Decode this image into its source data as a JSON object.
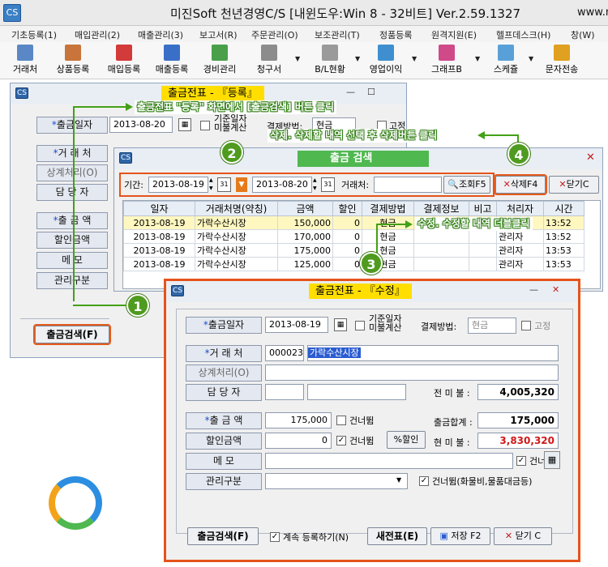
{
  "app": {
    "title": "미진Soft 천년경영C/S [내윈도우:Win 8 - 32비트] Ver.2.59.1327",
    "title_suffix": "www.m",
    "icon_text": "CS"
  },
  "menu": [
    "기초등록(1)",
    "매입관리(2)",
    "매출관리(3)",
    "보고서(R)",
    "주문관리(O)",
    "보조관리(T)",
    "정품등록",
    "원격지원(E)",
    "헬프데스크(H)",
    "창(W)"
  ],
  "toolbar": [
    "거래처",
    "상품등록",
    "매입등록",
    "매출등록",
    "경비관리",
    "청구서",
    "B/L현황",
    "영업이익",
    "그래프B",
    "스케쥴",
    "문자전송"
  ],
  "register": {
    "title": "출금전표 - 『등록』",
    "date_label": "출금일자",
    "date_value": "2013-08-20",
    "base_date_line1": "기준일자",
    "base_date_line2": "미불계산",
    "pay_method_label": "결제방법:",
    "pay_method_value": "현금",
    "fixed_label": "고정",
    "customer_label": "거 래 처",
    "offset_label": "상계처리(O)",
    "manager_label": "담 당 자",
    "amount_label": "출 금 액",
    "discount_label": "할인금액",
    "memo_label": "메    모",
    "class_label": "관리구분",
    "search_button": "출금검색(F)"
  },
  "search": {
    "title": "출금 검색",
    "period_label": "기간:",
    "date_from": "2013-08-19",
    "date_to": "2013-08-20",
    "customer_label": "거래처:",
    "query_button": "조회F5",
    "delete_button": "삭제F4",
    "close_button": "닫기C",
    "columns": [
      "일자",
      "거래처명(약칭)",
      "금액",
      "할인",
      "결제방법",
      "결제정보",
      "비고",
      "처리자",
      "시간"
    ],
    "rows": [
      [
        "2013-08-19",
        "가락수산시장",
        "150,000",
        "0",
        "현금",
        "",
        "",
        "관리자",
        "13:52"
      ],
      [
        "2013-08-19",
        "가락수산시장",
        "170,000",
        "0",
        "현금",
        "",
        "",
        "관리자",
        "13:52"
      ],
      [
        "2013-08-19",
        "가락수산시장",
        "175,000",
        "0",
        "현금",
        "",
        "",
        "관리자",
        "13:53"
      ],
      [
        "2013-08-19",
        "가락수산시장",
        "125,000",
        "0",
        "현금",
        "",
        "",
        "관리자",
        "13:53"
      ]
    ]
  },
  "edit": {
    "title": "출금전표 - 『수정』",
    "date_label": "출금일자",
    "date_value": "2013-08-19",
    "base_date_line1": "기준일자",
    "base_date_line2": "미불계산",
    "pay_method_label": "결제방법:",
    "pay_method_value": "현금",
    "fixed_label": "고정",
    "customer_label": "거 래 처",
    "customer_code": "000023",
    "customer_name": "가락수산시장",
    "offset_label": "상계처리(O)",
    "manager_label": "담 당 자",
    "prev_unpaid_label": "전 미 불 :",
    "prev_unpaid_value": "4,005,320",
    "amount_label": "출 금 액",
    "amount_value": "175,000",
    "skip_label": "건너뜀",
    "total_label": "출금합계 :",
    "total_value": "175,000",
    "discount_label": "할인금액",
    "discount_value": "0",
    "discount_button": "%할인",
    "cur_unpaid_label": "현 미 불 :",
    "cur_unpaid_value": "3,830,320",
    "memo_label": "메    모",
    "class_label": "관리구분",
    "class_skip_label": "건너뜀(화물비,물품대금등)",
    "search_button": "출금검색(F)",
    "continue_label": "계속 등록하기(N)",
    "new_button": "새전표(E)",
    "save_button": "저장 F2",
    "close_button": "닫기 C"
  },
  "annotations": {
    "step1_text": "출금전표 \"등록\" 화면에서 [출금검색] 버튼 클릭",
    "step_delete_text": "삭제. 삭제할 내역 선택 후 삭제버튼 클릭",
    "step_edit_text": "수정. 수정할 내역 더블클릭",
    "badges": [
      "1",
      "2",
      "3",
      "4"
    ]
  },
  "colors": {
    "title_highlight": "#ffde00",
    "annotation_green": "#43a016",
    "highlight_orange": "#e5531a",
    "unpaid_red": "#d01818"
  }
}
